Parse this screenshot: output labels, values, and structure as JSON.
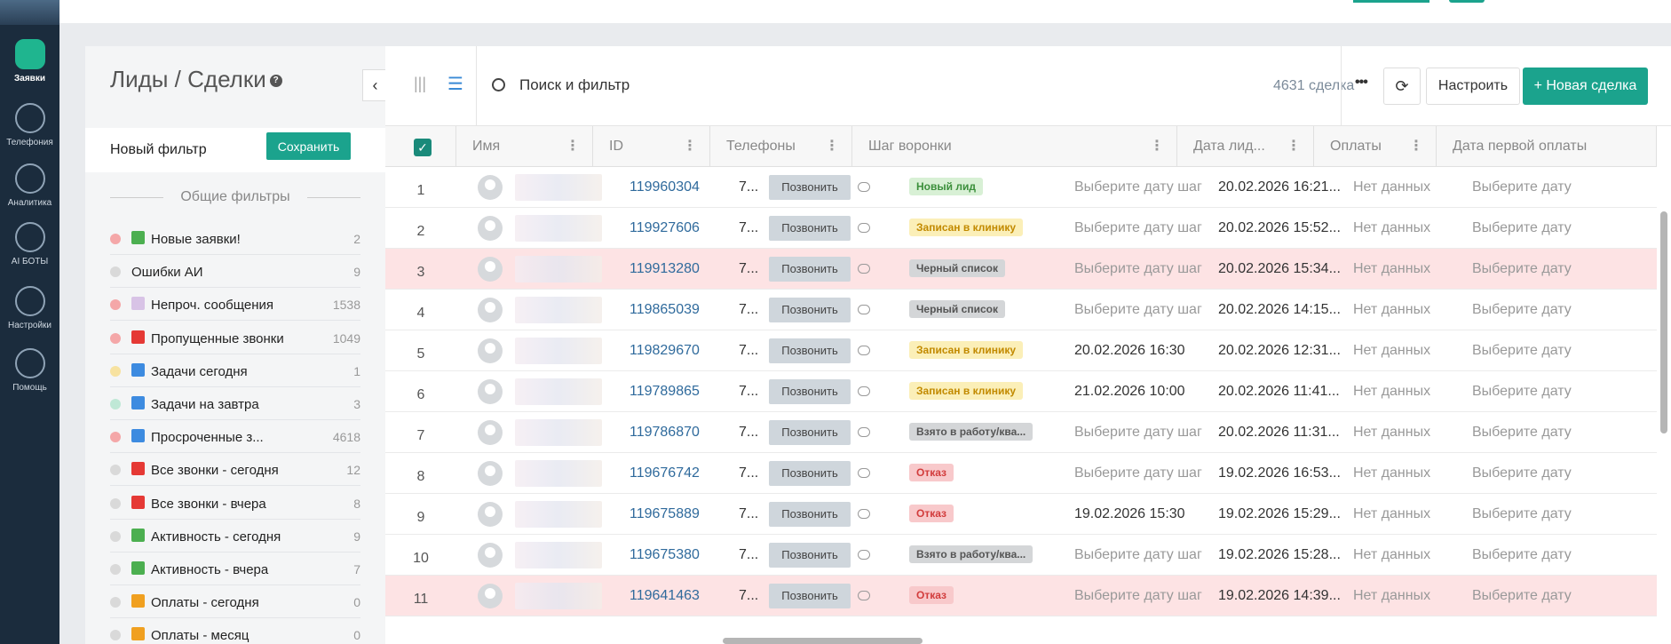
{
  "rail": {
    "items": [
      {
        "label": "Заявки",
        "icon": "list-board-icon"
      },
      {
        "label": "Телефония",
        "icon": "phone-icon"
      },
      {
        "label": "Аналитика",
        "icon": "analytics-icon"
      },
      {
        "label": "AI БОТЫ",
        "icon": "bot-icon"
      },
      {
        "label": "Настройки",
        "icon": "wrench-icon"
      },
      {
        "label": "Помощь",
        "icon": "chat-help-icon"
      }
    ]
  },
  "filters": {
    "title": "Лиды / Сделки",
    "help_icon": "?",
    "new_filter_label": "Новый фильтр",
    "save_label": "Сохранить",
    "section_title": "Общие фильтры",
    "items": [
      {
        "label": "Новые заявки!",
        "count": "2",
        "dot": "#f4a7a8",
        "emoji": "#4caf50"
      },
      {
        "label": "Ошибки АИ",
        "count": "9",
        "dot": "#d9d9d9",
        "emoji": ""
      },
      {
        "label": "Непроч. сообщения",
        "count": "1538",
        "dot": "#f4a7a8",
        "emoji": "#d8c3e6"
      },
      {
        "label": "Пропущенные звонки",
        "count": "1049",
        "dot": "#f4a7a8",
        "emoji": "#e53935"
      },
      {
        "label": "Задачи сегодня",
        "count": "1",
        "dot": "#f7e2a0",
        "emoji": "#3d8be0"
      },
      {
        "label": "Задачи на завтра",
        "count": "3",
        "dot": "#bfe8d6",
        "emoji": "#3d8be0"
      },
      {
        "label": "Просроченные з...",
        "count": "4618",
        "dot": "#f4a7a8",
        "emoji": "#3d8be0"
      },
      {
        "label": "Все звонки - сегодня",
        "count": "12",
        "dot": "#d9d9d9",
        "emoji": "#e53935"
      },
      {
        "label": "Все звонки - вчера",
        "count": "8",
        "dot": "#d9d9d9",
        "emoji": "#e53935"
      },
      {
        "label": "Активность - сегодня",
        "count": "9",
        "dot": "#d9d9d9",
        "emoji": "#4caf50"
      },
      {
        "label": "Активность - вчера",
        "count": "7",
        "dot": "#d9d9d9",
        "emoji": "#4caf50"
      },
      {
        "label": "Оплаты - сегодня",
        "count": "0",
        "dot": "#d9d9d9",
        "emoji": "#f0a020"
      },
      {
        "label": "Оплаты - месяц",
        "count": "0",
        "dot": "#d9d9d9",
        "emoji": "#f0a020"
      }
    ]
  },
  "toolbar": {
    "search_label": "Поиск и фильтр",
    "deal_count": "4631 сделка",
    "more_label": "•••",
    "refresh_icon": "⟳",
    "setup_label": "Настроить",
    "new_deal_label": "+ Новая сделка"
  },
  "table": {
    "columns": [
      "Имя",
      "ID",
      "Телефоны",
      "Шаг воронки",
      "Дата лид...",
      "Оплаты",
      "Дата первой оплаты"
    ],
    "call_label": "Позвонить",
    "phone_prefix": "7...",
    "rows": [
      {
        "n": "1",
        "id": "119960304",
        "stage": "Новый лид",
        "tone": "green",
        "step_date": "Выберите дату шага",
        "step_set": false,
        "lead_date": "20.02.2026 16:21...",
        "payments": "Нет данных",
        "first_pay": "Выберите дату",
        "red": false
      },
      {
        "n": "2",
        "id": "119927606",
        "stage": "Записан в клинику",
        "tone": "yellow",
        "step_date": "Выберите дату шага",
        "step_set": false,
        "lead_date": "20.02.2026 15:52...",
        "payments": "Нет данных",
        "first_pay": "Выберите дату",
        "red": false
      },
      {
        "n": "3",
        "id": "119913280",
        "stage": "Черный список",
        "tone": "gray",
        "step_date": "Выберите дату шага",
        "step_set": false,
        "lead_date": "20.02.2026 15:34...",
        "payments": "Нет данных",
        "first_pay": "Выберите дату",
        "red": true
      },
      {
        "n": "4",
        "id": "119865039",
        "stage": "Черный список",
        "tone": "gray",
        "step_date": "Выберите дату шага",
        "step_set": false,
        "lead_date": "20.02.2026 14:15...",
        "payments": "Нет данных",
        "first_pay": "Выберите дату",
        "red": false
      },
      {
        "n": "5",
        "id": "119829670",
        "stage": "Записан в клинику",
        "tone": "yellow",
        "step_date": "20.02.2026 16:30",
        "step_set": true,
        "lead_date": "20.02.2026 12:31...",
        "payments": "Нет данных",
        "first_pay": "Выберите дату",
        "red": false
      },
      {
        "n": "6",
        "id": "119789865",
        "stage": "Записан в клинику",
        "tone": "yellow",
        "step_date": "21.02.2026 10:00",
        "step_set": true,
        "lead_date": "20.02.2026 11:41...",
        "payments": "Нет данных",
        "first_pay": "Выберите дату",
        "red": false
      },
      {
        "n": "7",
        "id": "119786870",
        "stage": "Взято в работу/ква...",
        "tone": "gray",
        "step_date": "Выберите дату шага",
        "step_set": false,
        "lead_date": "20.02.2026 11:31...",
        "payments": "Нет данных",
        "first_pay": "Выберите дату",
        "red": false
      },
      {
        "n": "8",
        "id": "119676742",
        "stage": "Отказ",
        "tone": "red",
        "step_date": "Выберите дату шага",
        "step_set": false,
        "lead_date": "19.02.2026 16:53...",
        "payments": "Нет данных",
        "first_pay": "Выберите дату",
        "red": false
      },
      {
        "n": "9",
        "id": "119675889",
        "stage": "Отказ",
        "tone": "red",
        "step_date": "19.02.2026 15:30",
        "step_set": true,
        "lead_date": "19.02.2026 15:29...",
        "payments": "Нет данных",
        "first_pay": "Выберите дату",
        "red": false
      },
      {
        "n": "10",
        "id": "119675380",
        "stage": "Взято в работу/ква...",
        "tone": "gray",
        "step_date": "Выберите дату шага",
        "step_set": false,
        "lead_date": "19.02.2026 15:28...",
        "payments": "Нет данных",
        "first_pay": "Выберите дату",
        "red": false
      },
      {
        "n": "11",
        "id": "119641463",
        "stage": "Отказ",
        "tone": "red",
        "step_date": "Выберите дату шага",
        "step_set": false,
        "lead_date": "19.02.2026 14:39...",
        "payments": "Нет данных",
        "first_pay": "Выберите дату",
        "red": true
      }
    ]
  },
  "colors": {
    "accent": "#1ba38d",
    "rail": "#1b2c3d",
    "link": "#2f6a9c",
    "row_highlight": "#fde3e4"
  }
}
